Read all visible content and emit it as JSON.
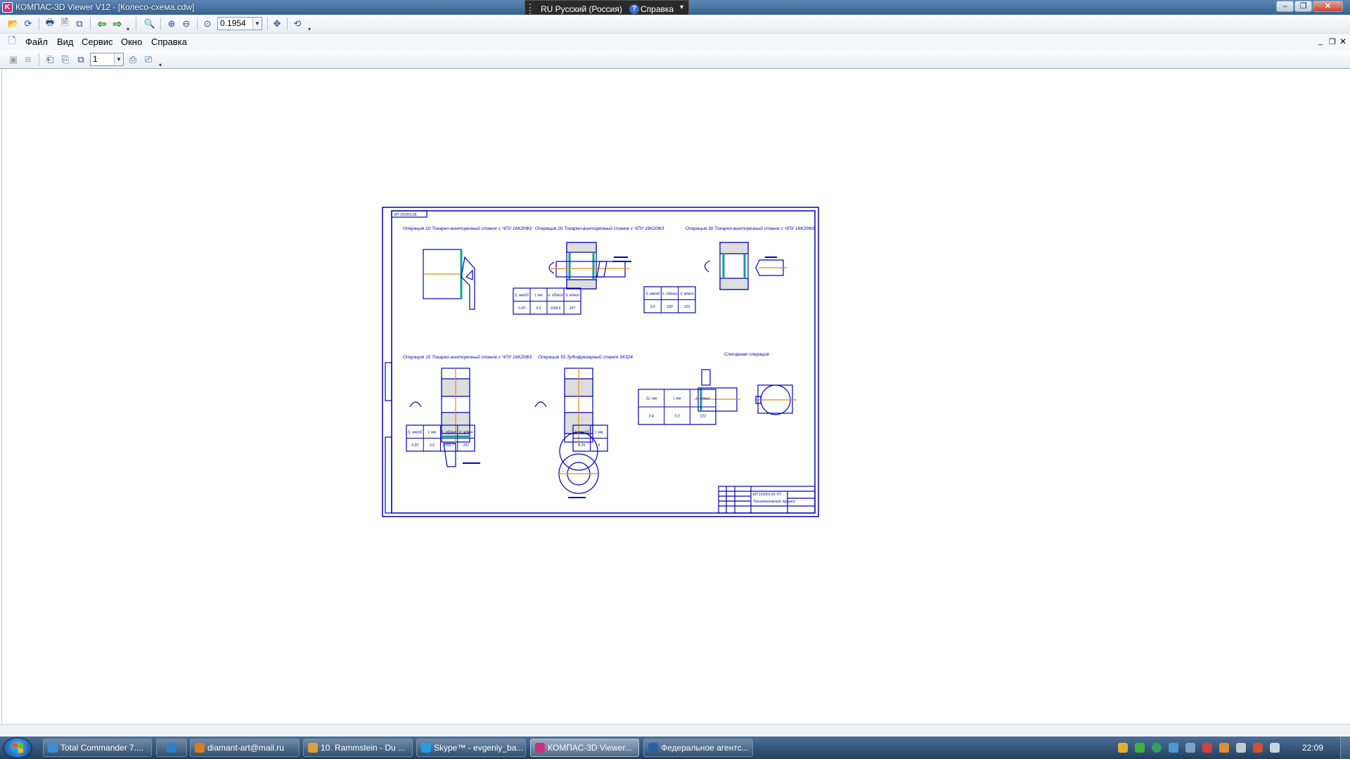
{
  "window": {
    "title": "КОМПАС-3D Viewer V12 - [Колесо-схема.cdw]",
    "app_icon_letter": "K"
  },
  "language_bar": {
    "language": "RU Русский (Россия)",
    "help_label": "Справка"
  },
  "toolbar": {
    "zoom_value": "0.1954"
  },
  "menu": {
    "items": [
      "Файл",
      "Вид",
      "Сервис",
      "Окно",
      "Справка"
    ]
  },
  "toolbar2": {
    "page_value": "1"
  },
  "drawing": {
    "stamp_code": "КП 151001.65",
    "operations": [
      {
        "title": "Операция 10 Токарно-винторезный станок с ЧПУ 16К20Ф3"
      },
      {
        "title": "Операция 20 Токарно-винторезный станок с ЧПУ 16К20Ф3"
      },
      {
        "title": "Операция 30 Токарно-винторезный станок с ЧПУ 16К20Ф3"
      },
      {
        "title": "Операция 15 Токарно-винторезный станок с ЧПУ 16К20Ф3"
      },
      {
        "title": "Операция 55 Зубофрезерный станок 5К324"
      },
      {
        "title": "Слесарная операция"
      }
    ],
    "tables": [
      {
        "headers": [
          "S, мм/об",
          "t, мм",
          "n, об/мин",
          "V, м/мин"
        ],
        "values": [
          "0.25",
          "0.5",
          "1168.6",
          "257"
        ]
      },
      {
        "headers": [
          "S, мм/об",
          "n, об/мин",
          "V, м/мин"
        ],
        "values": [
          "0.5",
          "190",
          "123"
        ]
      },
      {
        "headers": [
          "S, мм/об",
          "t, мм",
          "n, об/мин",
          "V, м/мин"
        ],
        "values": [
          "0.25",
          "0.5",
          "2311.7",
          "257"
        ]
      },
      {
        "headers": [
          "S, мм/об",
          "t, мм"
        ],
        "values": [
          "0.05",
          "3"
        ]
      },
      {
        "headers": [
          "Sz, мм",
          "t, мм",
          "V, м/мин"
        ],
        "values": [
          "0.4",
          "0.3",
          "123"
        ]
      }
    ],
    "title_block": {
      "code": "КП 151001.65 ТП",
      "name": "Технологический процесс"
    }
  },
  "taskbar": {
    "items": [
      {
        "label": "Total Commander 7....",
        "color": "#3c8fd6"
      },
      {
        "label": "",
        "color": "#2f7fd0"
      },
      {
        "label": "diamant-art@mail.ru",
        "color": "#e07b1c"
      },
      {
        "label": "10. Rammstein - Du ...",
        "color": "#d8a23a"
      },
      {
        "label": "Skype™ - evgeniy_ba...",
        "color": "#1fa0e0"
      },
      {
        "label": "КОМПАС-3D Viewer...",
        "color": "#c8307a"
      },
      {
        "label": "Федеральное агентс...",
        "color": "#2b5ea8"
      }
    ],
    "clock": "22:09"
  }
}
